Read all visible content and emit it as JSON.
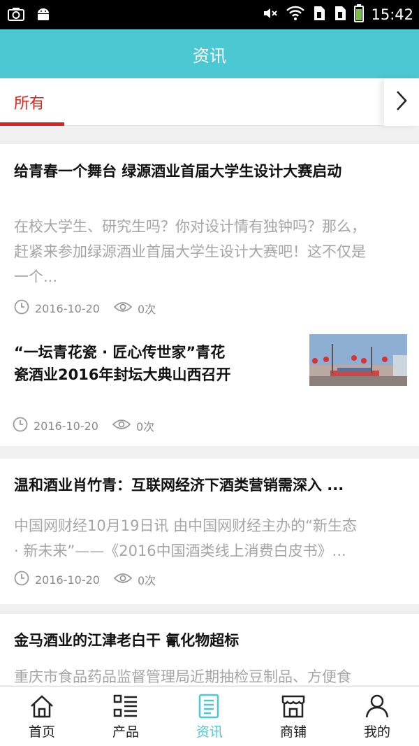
{
  "status_bar": {
    "time": "15:42",
    "left_icons": [
      "camera-icon",
      "android-icon"
    ],
    "right_icons": [
      "mute-icon",
      "wifi-icon",
      "sim1-icon",
      "sim2-icon",
      "battery-icon"
    ]
  },
  "header": {
    "title": "资讯"
  },
  "tabs": [
    {
      "label": "所有",
      "active": true
    }
  ],
  "more_tabs_icon": "chevron-right-icon",
  "articles": [
    {
      "title": "给青春一个舞台 绿源酒业首届大学生设计大赛启动",
      "summary_line1": "在校大学生、研究生吗？你对设计情有独钟吗？那么，",
      "summary_line2": "赶紧来参加绿源酒业首届大学生设计大赛吧！这不仅是",
      "summary_line3": "一个...",
      "date": "2016-10-20",
      "views": "0次"
    },
    {
      "title_line1": "“一坛青花瓷 · 匠心传世家”青花",
      "title_line2": "瓷酒业2016年封坛大典山西召开",
      "date": "2016-10-20",
      "views": "0次",
      "has_thumbnail": true
    },
    {
      "title": "温和酒业肖竹青：互联网经济下酒类营销需深入 ...",
      "summary_line1": "中国网财经10月19日讯 由中国网财经主办的“新生态",
      "summary_line2": "· 新未来”——《2016中国酒类线上消费白皮书》...",
      "date": "2016-10-20",
      "views": "0次"
    },
    {
      "title": "金马酒业的江津老白干 氰化物超标",
      "summary_line1": "重庆市食品药品监督管理局近期抽检豆制品、方便食"
    }
  ],
  "bottom_nav": [
    {
      "label": "首页",
      "icon": "home-icon",
      "active": false
    },
    {
      "label": "产品",
      "icon": "list-icon",
      "active": false
    },
    {
      "label": "资讯",
      "icon": "news-icon",
      "active": true
    },
    {
      "label": "商铺",
      "icon": "shop-icon",
      "active": false
    },
    {
      "label": "我的",
      "icon": "user-icon",
      "active": false
    }
  ],
  "colors": {
    "header_bg": "#4cc8d2",
    "tab_active": "#d9231d",
    "nav_active": "#4cc8d2"
  }
}
